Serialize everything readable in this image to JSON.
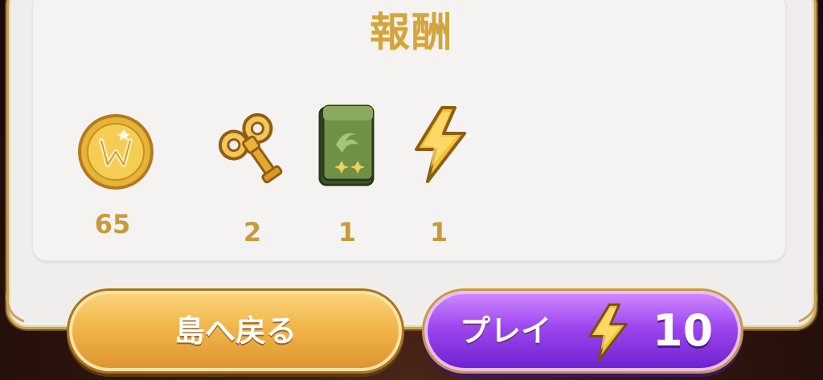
{
  "title": "報酬",
  "rewards": [
    {
      "icon": "gold-coin-icon",
      "count": "65"
    },
    {
      "icon": "wind-up-key-icon",
      "count": "2"
    },
    {
      "icon": "green-card-pack-icon",
      "count": "1"
    },
    {
      "icon": "lightning-energy-icon",
      "count": "1"
    }
  ],
  "buttons": {
    "back_label": "島へ戻る",
    "play_label": "プレイ",
    "play_cost": "10",
    "play_cost_icon": "lightning-energy-icon"
  },
  "colors": {
    "title_gold": "#d3a53f",
    "count_gold": "#c79a3c",
    "back_button": "#f1b64a",
    "play_button": "#9c47ef",
    "panel": "#efeeec"
  }
}
